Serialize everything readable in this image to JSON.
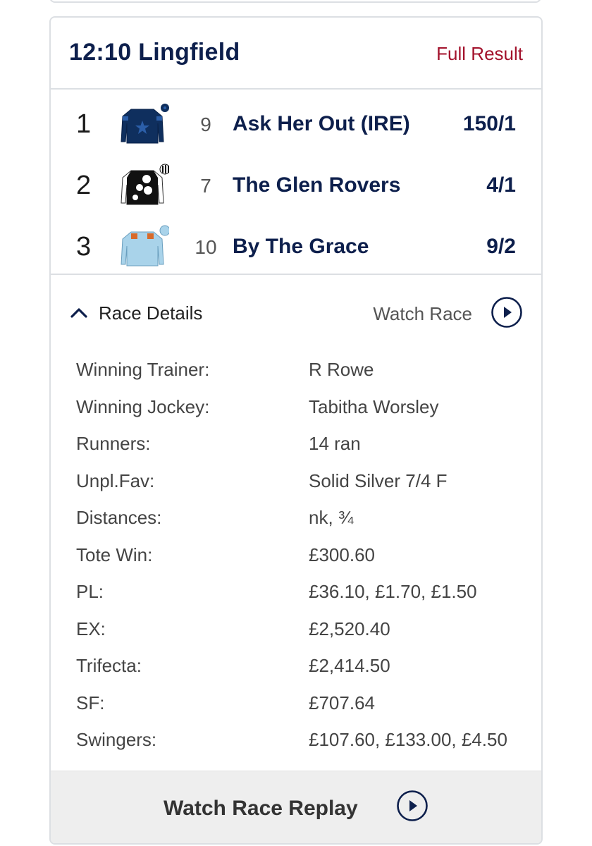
{
  "race": {
    "title": "12:10 Lingfield",
    "full_result_label": "Full Result"
  },
  "runners": [
    {
      "position": "1",
      "cloth": "9",
      "horse": "Ask Her Out (IRE)",
      "odds": "150/1",
      "silk": "dark-blue-star-silk-icon"
    },
    {
      "position": "2",
      "cloth": "7",
      "horse": "The Glen Rovers",
      "odds": "4/1",
      "silk": "black-white-spots-silk-icon"
    },
    {
      "position": "3",
      "cloth": "10",
      "horse": "By The Grace",
      "odds": "9/2",
      "silk": "light-blue-orange-silk-icon"
    }
  ],
  "details_toggle": {
    "label": "Race Details",
    "icon": "chevron-up-icon"
  },
  "watch_race": {
    "label": "Watch Race",
    "icon": "play-circle-icon"
  },
  "details": [
    {
      "key": "Winning Trainer:",
      "value": "R Rowe"
    },
    {
      "key": "Winning Jockey:",
      "value": "Tabitha Worsley"
    },
    {
      "key": "Runners:",
      "value": "14 ran"
    },
    {
      "key": "Unpl.Fav:",
      "value": "Solid Silver 7/4 F"
    },
    {
      "key": "Distances:",
      "value": "nk, ¾"
    },
    {
      "key": "Tote Win:",
      "value": "£300.60"
    },
    {
      "key": "PL:",
      "value": "£36.10, £1.70, £1.50"
    },
    {
      "key": "EX:",
      "value": "£2,520.40"
    },
    {
      "key": "Trifecta:",
      "value": "£2,414.50"
    },
    {
      "key": "SF:",
      "value": "£707.64"
    },
    {
      "key": "Swingers:",
      "value": "£107.60, £133.00, £4.50"
    }
  ],
  "replay": {
    "label": "Watch Race Replay",
    "icon": "play-circle-icon"
  },
  "colors": {
    "navy": "#0d1f4c",
    "accent_red": "#a3132d",
    "border": "#dcdfe3",
    "replay_bg": "#eeeeee"
  }
}
